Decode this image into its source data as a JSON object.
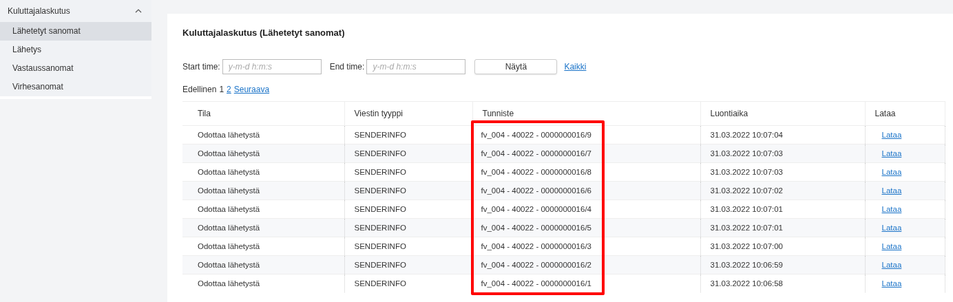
{
  "sidebar": {
    "group": {
      "label": "Kuluttajalaskutus",
      "expanded": true
    },
    "items": [
      {
        "label": "Lähetetyt sanomat",
        "selected": true
      },
      {
        "label": "Lähetys",
        "selected": false
      },
      {
        "label": "Vastaussanomat",
        "selected": false
      },
      {
        "label": "Virhesanomat",
        "selected": false
      }
    ]
  },
  "title": "Kuluttajalaskutus (Lähetetyt sanomat)",
  "filters": {
    "start_label": "Start time:",
    "start": {
      "placeholder": "y-m-d h:m:s"
    },
    "end_label": "End time:",
    "end": {
      "placeholder": "y-m-d h:m:s"
    },
    "show_button": "Näytä",
    "all_link": "Kaikki"
  },
  "pagination": {
    "previous": "Edellinen",
    "pages": [
      {
        "label": "1",
        "selected": true
      },
      {
        "label": "2",
        "selected": false
      }
    ],
    "next": "Seuraava"
  },
  "table": {
    "columns": [
      "Tila",
      "Viestin tyyppi",
      "Tunniste",
      "Luontiaika",
      "Lataa"
    ],
    "rows": [
      [
        "Odottaa lähetystä",
        "SENDERINFO",
        "fv_004 - 40022 - 0000000016/9",
        "31.03.2022 10:07:04",
        "Lataa"
      ],
      [
        "Odottaa lähetystä",
        "SENDERINFO",
        "fv_004 - 40022 - 0000000016/7",
        "31.03.2022 10:07:03",
        "Lataa"
      ],
      [
        "Odottaa lähetystä",
        "SENDERINFO",
        "fv_004 - 40022 - 0000000016/8",
        "31.03.2022 10:07:03",
        "Lataa"
      ],
      [
        "Odottaa lähetystä",
        "SENDERINFO",
        "fv_004 - 40022 - 0000000016/6",
        "31.03.2022 10:07:02",
        "Lataa"
      ],
      [
        "Odottaa lähetystä",
        "SENDERINFO",
        "fv_004 - 40022 - 0000000016/4",
        "31.03.2022 10:07:01",
        "Lataa"
      ],
      [
        "Odottaa lähetystä",
        "SENDERINFO",
        "fv_004 - 40022 - 0000000016/5",
        "31.03.2022 10:07:01",
        "Lataa"
      ],
      [
        "Odottaa lähetystä",
        "SENDERINFO",
        "fv_004 - 40022 - 0000000016/3",
        "31.03.2022 10:07:00",
        "Lataa"
      ],
      [
        "Odottaa lähetystä",
        "SENDERINFO",
        "fv_004 - 40022 - 0000000016/2",
        "31.03.2022 10:06:59",
        "Lataa"
      ],
      [
        "Odottaa lähetystä",
        "SENDERINFO",
        "fv_004 - 40022 - 0000000016/1",
        "31.03.2022 10:06:58",
        "Lataa"
      ]
    ]
  }
}
